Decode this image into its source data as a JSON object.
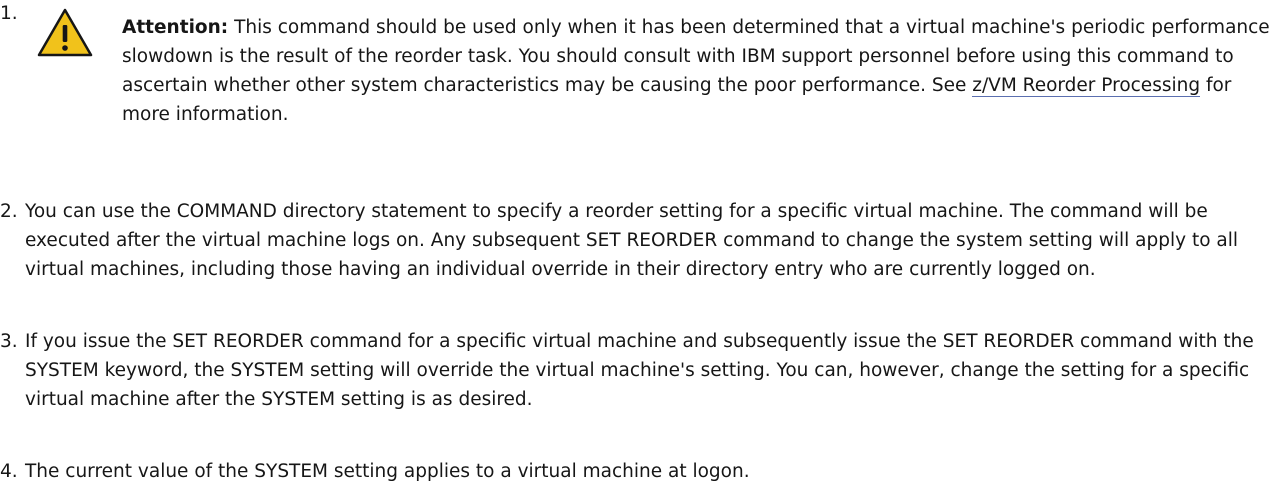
{
  "notes": [
    {
      "number": "1.",
      "icon": "warning-icon",
      "attention_label": "Attention:",
      "text_before_link": " This command should be used only when it has been determined that a virtual machine's periodic performance slowdown is the result of the reorder task. You should consult with IBM support personnel before using this command to ascertain whether other system characteristics may be causing the poor performance. See ",
      "link_text": "z/VM Reorder Processing",
      "text_after_link": " for more information."
    },
    {
      "number": "2.",
      "text": "You can use the COMMAND directory statement to specify a reorder setting for a specific virtual machine. The command will be executed after the virtual machine logs on. Any subsequent SET REORDER command to change the system setting will apply to all virtual machines, including those having an individual override in their directory entry who are currently logged on."
    },
    {
      "number": "3.",
      "text": "If you issue the SET REORDER command for a specific virtual machine and subsequently issue the SET REORDER command with the SYSTEM keyword, the SYSTEM setting will override the virtual machine's setting. You can, however, change the setting for a specific virtual machine after the SYSTEM setting is as desired."
    },
    {
      "number": "4.",
      "text": "The current value of the SYSTEM setting applies to a virtual machine at logon."
    }
  ],
  "colors": {
    "text": "#161616",
    "warning_fill": "#f1c21b",
    "warning_stroke": "#161616",
    "link_underline": "#5b6fb0"
  }
}
